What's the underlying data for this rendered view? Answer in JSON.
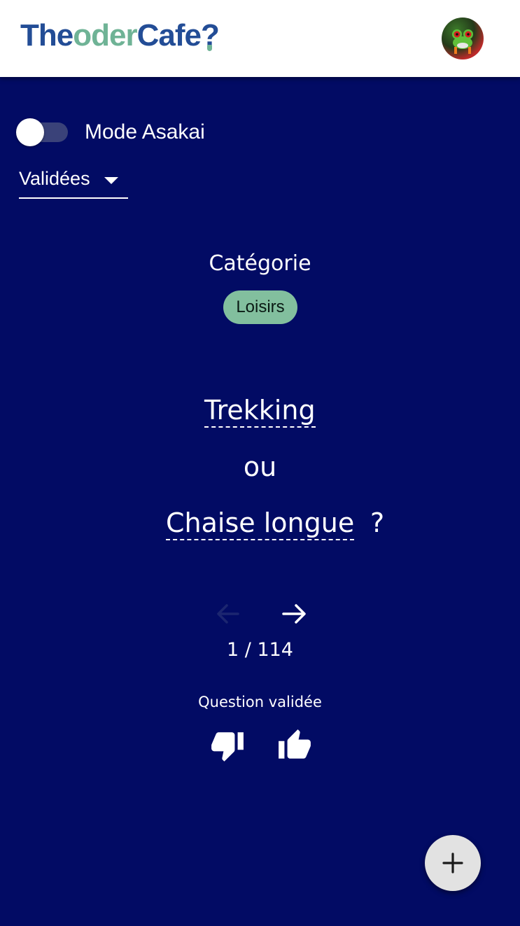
{
  "header": {
    "logo": {
      "part1": "The",
      "part2": "oder",
      "part3": "Cafe",
      "part4": "?"
    },
    "avatar_icon": "frog-avatar"
  },
  "controls": {
    "toggle_label": "Mode Asakai",
    "toggle_on": false,
    "filter_value": "Validées"
  },
  "question": {
    "category_title": "Catégorie",
    "category": "Loisirs",
    "option_a": "Trekking",
    "separator": "ou",
    "option_b": "Chaise longue",
    "question_mark": "?"
  },
  "pagination": {
    "text": "1 / 114",
    "prev_icon": "arrow-left-icon",
    "next_icon": "arrow-right-icon"
  },
  "status": {
    "text": "Question validée",
    "dislike_icon": "thumb-down-icon",
    "like_icon": "thumb-up-icon"
  },
  "fab": {
    "icon": "plus-icon"
  },
  "colors": {
    "background": "#020b64",
    "logo_blue": "#234d96",
    "logo_green": "#6fb396",
    "chip": "#82bf9e",
    "fab": "#e2e2e2"
  }
}
